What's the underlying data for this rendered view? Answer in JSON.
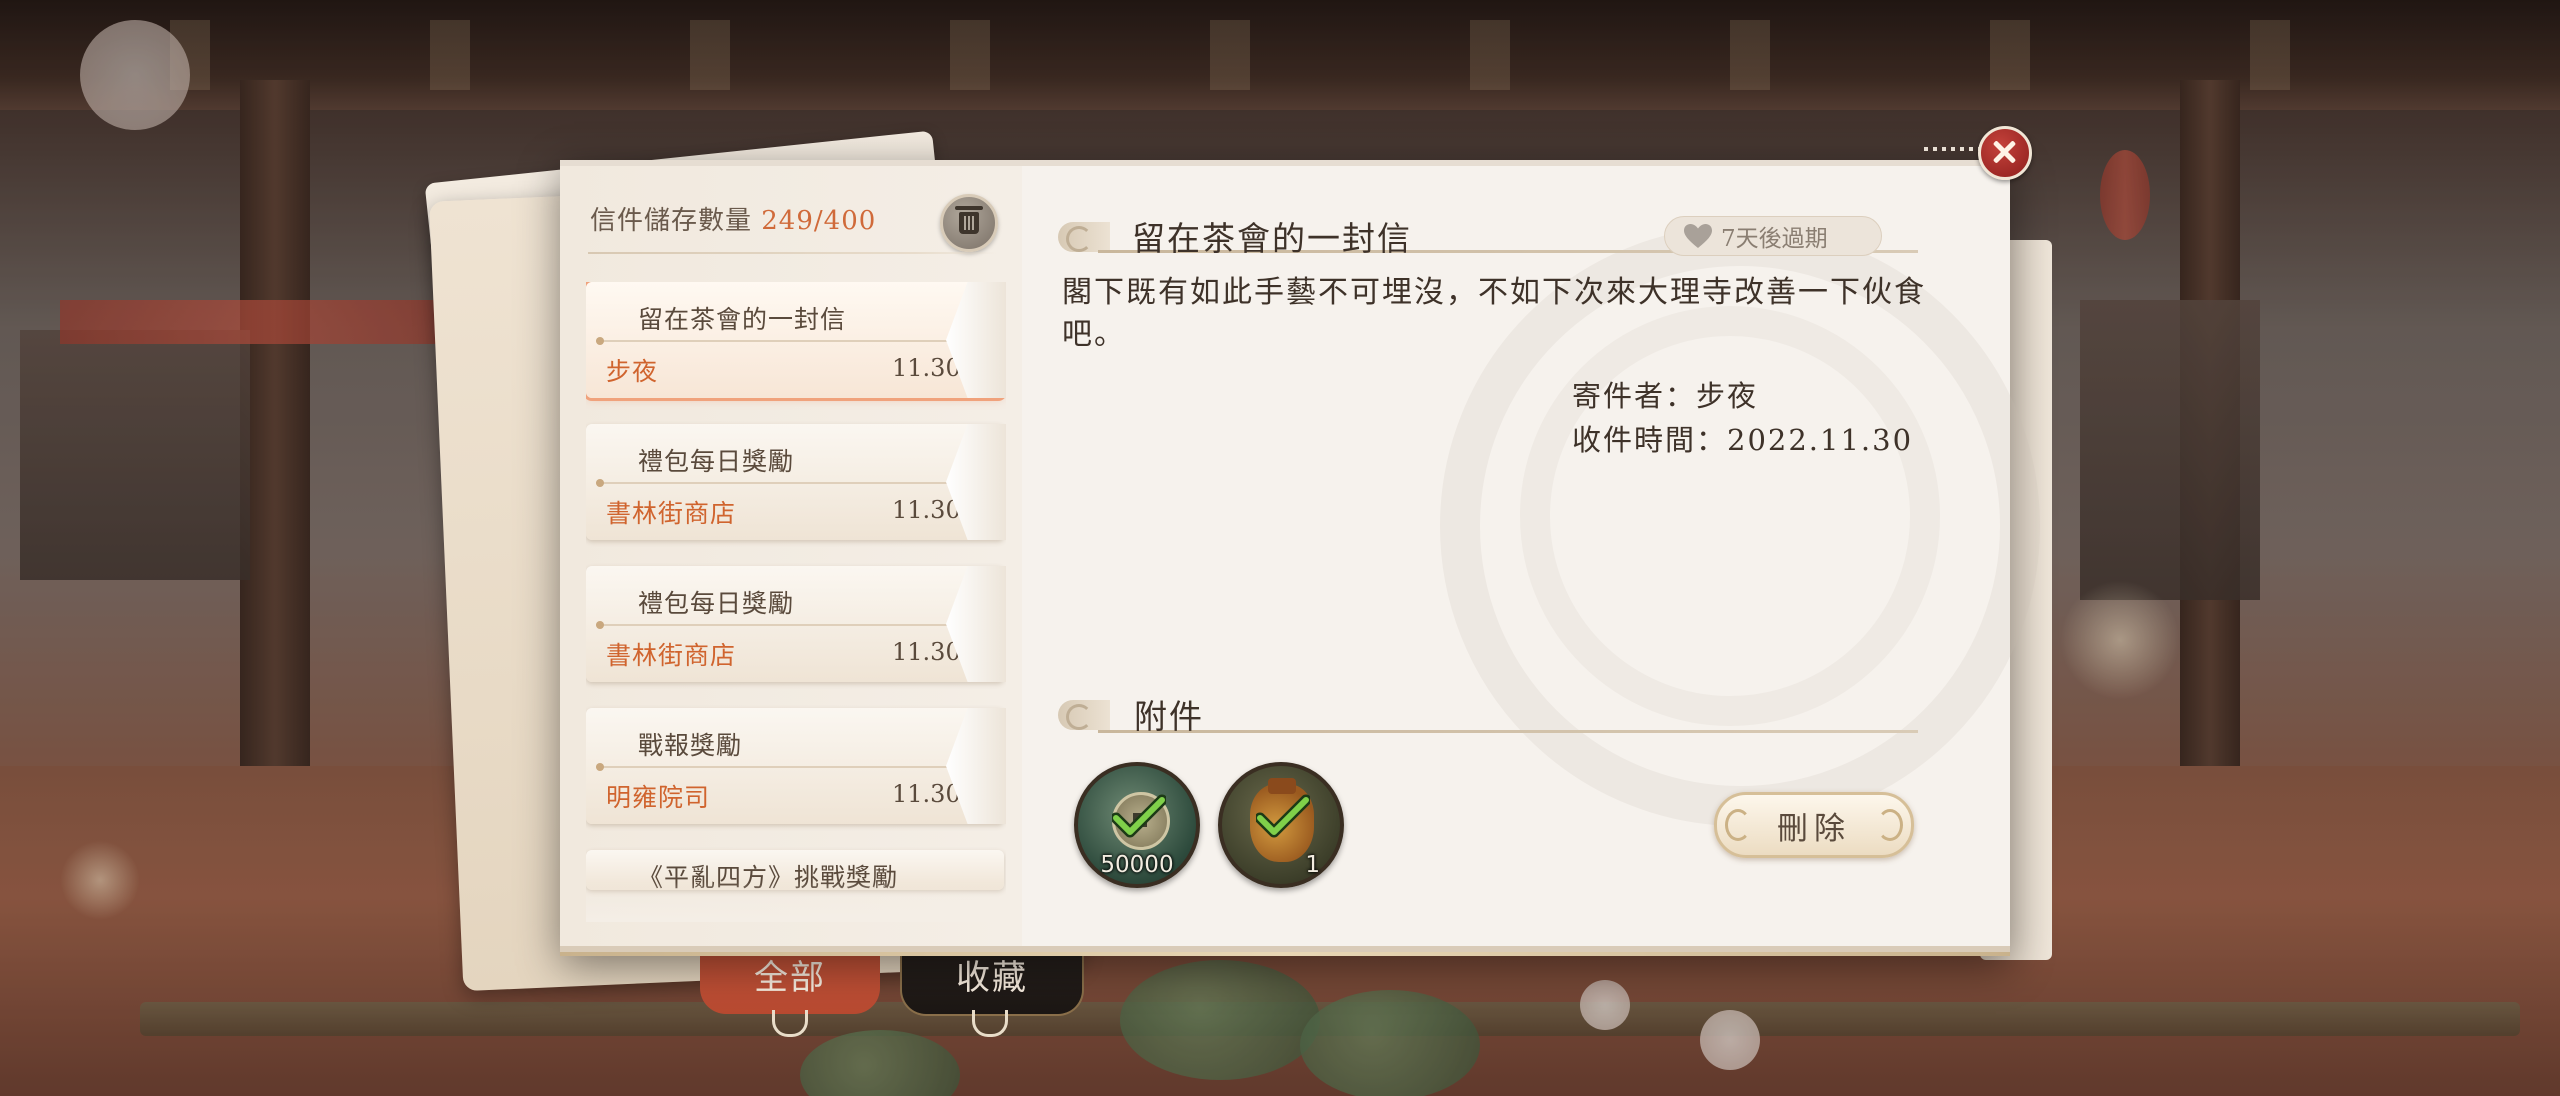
{
  "storage": {
    "label": "信件儲存數量 ",
    "count": "249/400"
  },
  "mails": [
    {
      "title": "留在茶會的一封信",
      "sender": "步夜",
      "date": "11.30",
      "selected": true
    },
    {
      "title": "禮包每日獎勵",
      "sender": "書林街商店",
      "date": "11.30"
    },
    {
      "title": "禮包每日獎勵",
      "sender": "書林街商店",
      "date": "11.30"
    },
    {
      "title": "戰報獎勵",
      "sender": "明雍院司",
      "date": "11.30"
    },
    {
      "title": "《平亂四方》挑戰獎勵",
      "sender": "",
      "date": ""
    }
  ],
  "detail": {
    "subject": "留在茶會的一封信",
    "expiry": "7天後過期",
    "body": "閣下既有如此手藝不可埋沒，不如下次來大理寺改善一下伙食吧。",
    "sender_line": "寄件者：步夜",
    "time_line": "收件時間：2022.11.30",
    "attachments_title": "附件",
    "attachments": [
      {
        "name": "coin",
        "quantity": "50000",
        "claimed": true
      },
      {
        "name": "bag",
        "quantity": "1",
        "claimed": true
      }
    ],
    "delete_label": "刪除"
  },
  "tabs": {
    "all": "全部",
    "favorites": "收藏"
  },
  "colors": {
    "accent": "#d06a3a",
    "close": "#b2302c",
    "tab_active": "#c9573b",
    "tab_inactive": "#1c1714"
  }
}
